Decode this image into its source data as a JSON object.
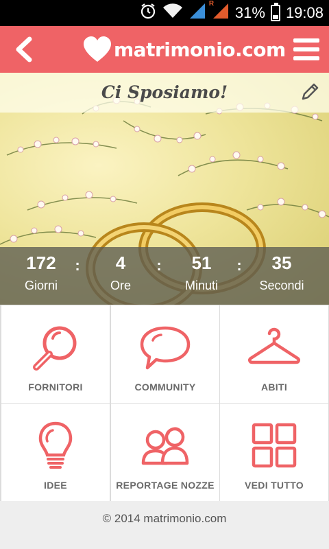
{
  "statusbar": {
    "alarm_icon": "alarm-clock-icon",
    "wifi_icon": "wifi-icon",
    "signal_icons": [
      "signal-bars-icon",
      "roaming-signal-bars-icon"
    ],
    "roaming_marker": "R",
    "battery": "31%",
    "battery_level": 0.31,
    "time": "19:08"
  },
  "appbar": {
    "color": "#ef6366",
    "back_icon": "chevron-left-icon",
    "logo_text": "matrimonio.com",
    "menu_icon": "hamburger-menu-icon"
  },
  "hero": {
    "title": "Ci Sposiamo!",
    "edit_icon": "pencil-icon"
  },
  "countdown": [
    {
      "value": "172",
      "label": "Giorni"
    },
    {
      "value": "4",
      "label": "Ore"
    },
    {
      "value": "51",
      "label": "Minuti"
    },
    {
      "value": "35",
      "label": "Secondi"
    }
  ],
  "countdown_separator": ":",
  "tiles": [
    {
      "label": "FORNITORI",
      "icon": "magnifier-icon"
    },
    {
      "label": "COMMUNITY",
      "icon": "speech-bubble-icon"
    },
    {
      "label": "ABITI",
      "icon": "clothes-hanger-icon"
    },
    {
      "label": "IDEE",
      "icon": "lightbulb-icon"
    },
    {
      "label": "REPORTAGE NOZZE",
      "icon": "couple-icon"
    },
    {
      "label": "VEDI TUTTO",
      "icon": "grid-icon"
    }
  ],
  "accent": "#ef6366",
  "footer": {
    "text": "© 2014 matrimonio.com"
  }
}
